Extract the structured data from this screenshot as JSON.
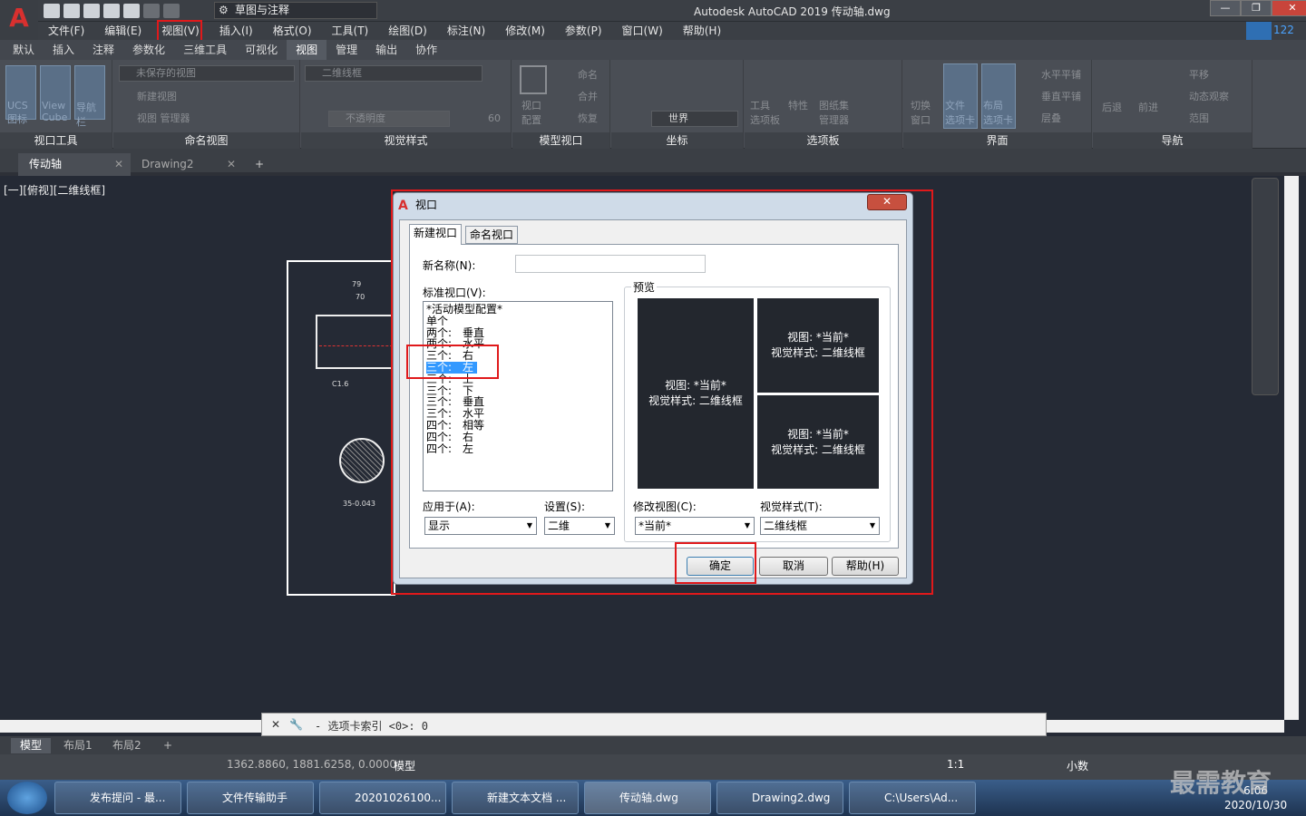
{
  "app": {
    "logo": "A",
    "workspace": "草图与注释",
    "title": "Autodesk AutoCAD 2019 传动轴.dwg",
    "signin_count": "122"
  },
  "menus": [
    "文件(F)",
    "编辑(E)",
    "视图(V)",
    "插入(I)",
    "格式(O)",
    "工具(T)",
    "绘图(D)",
    "标注(N)",
    "修改(M)",
    "参数(P)",
    "窗口(W)",
    "帮助(H)"
  ],
  "ribbon_tabs": [
    "默认",
    "插入",
    "注释",
    "参数化",
    "三维工具",
    "可视化",
    "视图",
    "管理",
    "输出",
    "协作"
  ],
  "ribbon_active": "视图",
  "panels": {
    "viewport_tools": {
      "label": "视口工具",
      "items": [
        "UCS 图标",
        "View Cube",
        "导航栏"
      ]
    },
    "named_views": {
      "label": "命名视图",
      "combo": "未保存的视图",
      "items": [
        "新建视图",
        "视图 管理器"
      ]
    },
    "visual_styles": {
      "label": "视觉样式",
      "combo": "二维线框",
      "opacity_label": "不透明度",
      "opacity_value": "60"
    },
    "model_viewports": {
      "label": "模型视口",
      "items": [
        "视口 配置",
        "命名",
        "合并",
        "恢复"
      ]
    },
    "coordinates": {
      "label": "坐标",
      "combo": "世界"
    },
    "palettes": {
      "label": "选项板",
      "items": [
        "工具 选项板",
        "特性",
        "图纸集 管理器"
      ]
    },
    "interface": {
      "label": "界面",
      "items": [
        "切换 窗口",
        "文件 选项卡",
        "布局 选项卡",
        "水平平铺",
        "垂直平铺",
        "层叠"
      ]
    },
    "navigate": {
      "label": "导航",
      "items": [
        "后退",
        "前进",
        "平移",
        "动态观察",
        "范围"
      ]
    }
  },
  "doc_tabs": [
    "传动轴",
    "Drawing2"
  ],
  "viewport_label": "[一][俯视][二维线框]",
  "drawing": {
    "dim1": "79",
    "dim2": "70",
    "dim3": "C1.6",
    "dim4": "35-0.043"
  },
  "dialog": {
    "title": "视口",
    "tabs": [
      "新建视口",
      "命名视口"
    ],
    "new_name_label": "新名称(N):",
    "new_name_value": "",
    "std_label": "标准视口(V):",
    "std_items": [
      "*活动模型配置*",
      "单个",
      "两个:　垂直",
      "两个:　水平",
      "三个:　右",
      "三个:　左",
      "三个:　上",
      "三个:　下",
      "三个:　垂直",
      "三个:　水平",
      "四个:　相等",
      "四个:　右",
      "四个:　左"
    ],
    "selected_index": 5,
    "preview_label": "预览",
    "preview_view": "视图: *当前*",
    "preview_style": "视觉样式: 二维线框",
    "apply_label": "应用于(A):",
    "apply_value": "显示",
    "setup_label": "设置(S):",
    "setup_value": "二维",
    "change_view_label": "修改视图(C):",
    "change_view_value": "*当前*",
    "visual_style_label": "视觉样式(T):",
    "visual_style_value": "二维线框",
    "ok": "确定",
    "cancel": "取消",
    "help": "帮助(H)"
  },
  "command_line": "- 选项卡索引 <0>: 0",
  "layout_tabs": [
    "模型",
    "布局1",
    "布局2"
  ],
  "status": {
    "coords": "1362.8860, 1881.6258, 0.0000",
    "mode": "模型",
    "scale": "1:1",
    "units": "小数"
  },
  "taskbar": [
    "发布提问 - 最...",
    "文件传输助手",
    "20201026100...",
    "新建文本文档 ...",
    "传动轴.dwg",
    "Drawing2.dwg",
    "C:\\Users\\Ad..."
  ],
  "clock": {
    "time": "6:06",
    "date": "2020/10/30"
  },
  "watermark": "最需教育"
}
